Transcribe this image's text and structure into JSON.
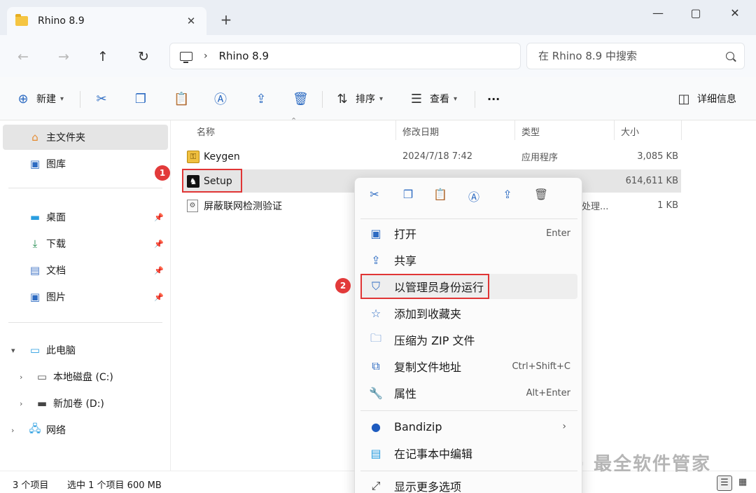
{
  "window": {
    "tab_title": "Rhino 8.9",
    "tab_close": "✕",
    "new_tab": "+",
    "controls": {
      "minimize": "—",
      "maximize": "▢",
      "close": "✕"
    }
  },
  "address": {
    "breadcrumb_chevron": "›",
    "path": "Rhino 8.9",
    "search_placeholder": "在 Rhino 8.9 中搜索"
  },
  "toolbar": {
    "new_label": "新建",
    "sort_label": "排序",
    "view_label": "查看",
    "more_label": "···",
    "details_label": "详细信息"
  },
  "sidebar": {
    "home": "主文件夹",
    "gallery": "图库",
    "desktop": "桌面",
    "downloads": "下载",
    "documents": "文档",
    "pictures": "图片",
    "this_pc": "此电脑",
    "local_disk": "本地磁盘 (C:)",
    "new_volume": "新加卷 (D:)",
    "network": "网络"
  },
  "columns": {
    "name": "名称",
    "modified": "修改日期",
    "type": "类型",
    "size": "大小"
  },
  "files": [
    {
      "name": "Keygen",
      "modified": "2024/7/18 7:42",
      "type": "应用程序",
      "size": "3,085 KB"
    },
    {
      "name": "Setup",
      "modified": "",
      "type": "",
      "size": "614,611 KB"
    },
    {
      "name": "屏蔽联网检测验证",
      "modified": "",
      "type": "处理...",
      "size": "1 KB"
    }
  ],
  "annotations": {
    "badge1": "1",
    "badge2": "2"
  },
  "context_menu": {
    "items": [
      {
        "label": "打开",
        "shortcut": "Enter"
      },
      {
        "label": "共享",
        "shortcut": ""
      },
      {
        "label": "以管理员身份运行",
        "shortcut": ""
      },
      {
        "label": "添加到收藏夹",
        "shortcut": ""
      },
      {
        "label": "压缩为 ZIP 文件",
        "shortcut": ""
      },
      {
        "label": "复制文件地址",
        "shortcut": "Ctrl+Shift+C"
      },
      {
        "label": "属性",
        "shortcut": "Alt+Enter"
      },
      {
        "label": "Bandizip",
        "shortcut": ""
      },
      {
        "label": "在记事本中编辑",
        "shortcut": ""
      },
      {
        "label": "显示更多选项",
        "shortcut": ""
      }
    ]
  },
  "status": {
    "item_count": "3 个项目",
    "selected": "选中 1 个项目  600 MB"
  },
  "watermark": "公众号 · 最全软件管家",
  "colors": {
    "accent": "#2d6bc2",
    "annotation_red": "#e03535"
  }
}
